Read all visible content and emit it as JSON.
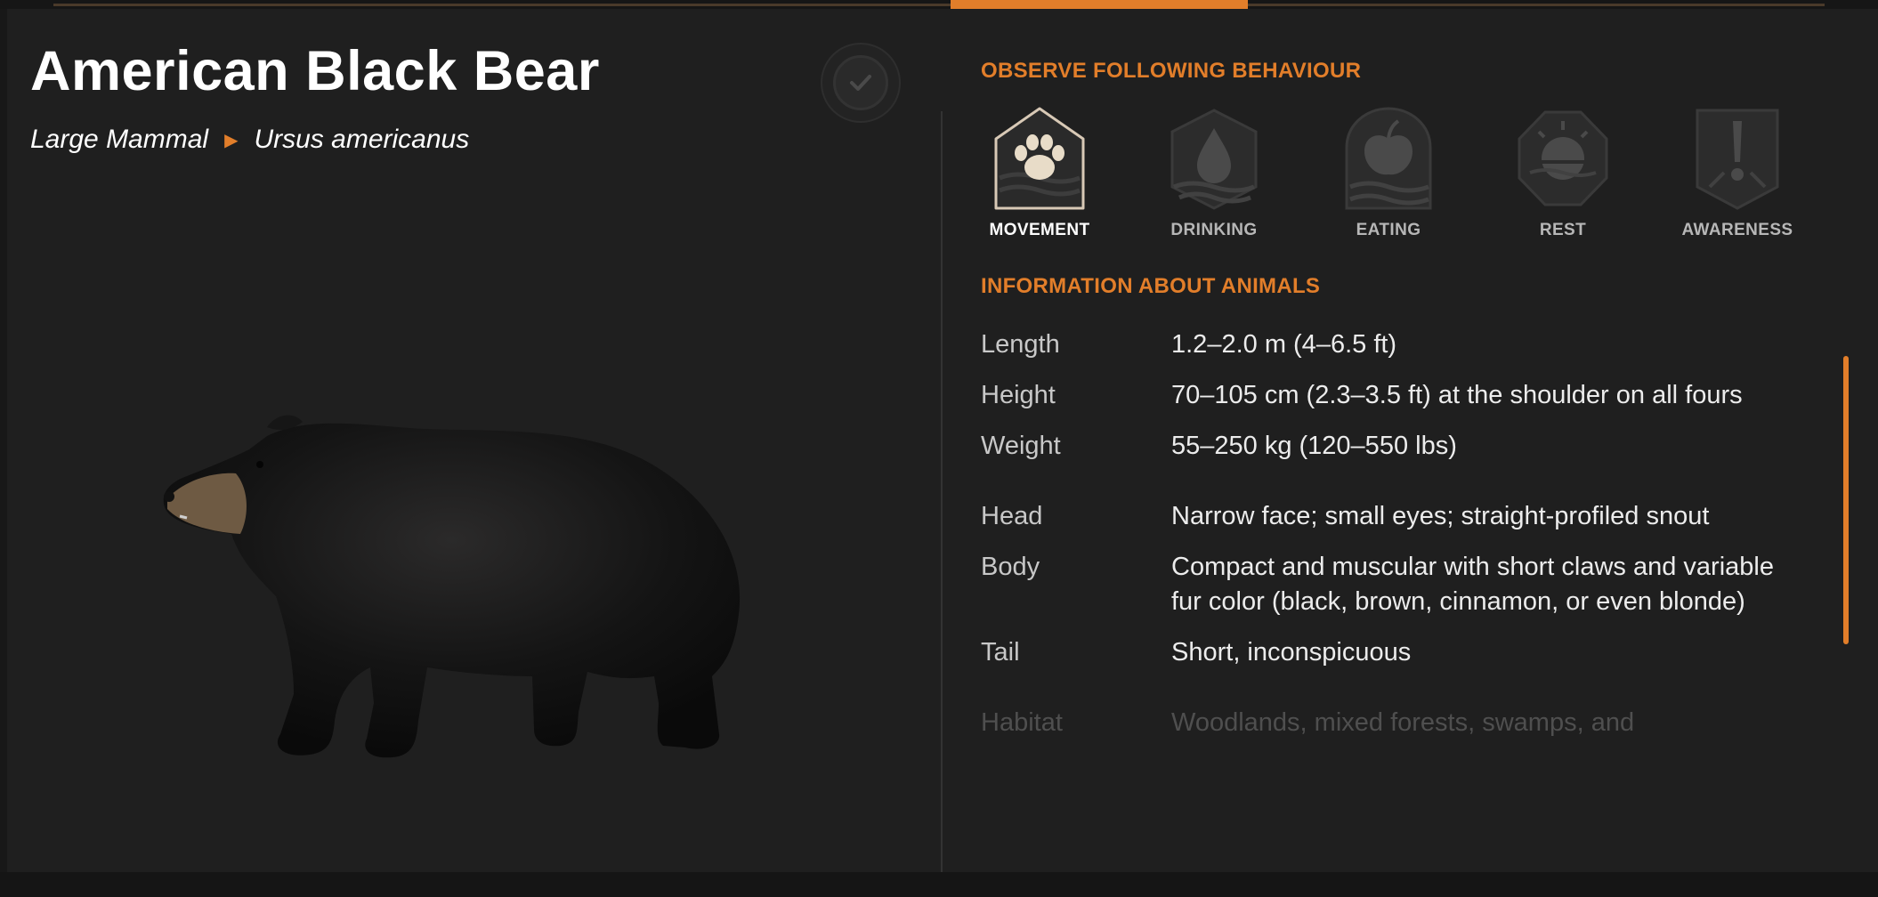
{
  "animal": {
    "name": "American Black Bear",
    "category": "Large Mammal",
    "species": "Ursus americanus"
  },
  "behaviour_section": {
    "heading": "OBSERVE FOLLOWING BEHAVIOUR",
    "items": [
      {
        "label": "MOVEMENT",
        "icon": "paw-icon",
        "active": true
      },
      {
        "label": "DRINKING",
        "icon": "water-drop-icon",
        "active": false
      },
      {
        "label": "EATING",
        "icon": "apple-icon",
        "active": false
      },
      {
        "label": "REST",
        "icon": "sun-icon",
        "active": false
      },
      {
        "label": "AWARENESS",
        "icon": "exclamation-icon",
        "active": false
      }
    ]
  },
  "info_section": {
    "heading": "INFORMATION ABOUT ANIMALS",
    "rows": [
      {
        "key": "Length",
        "value": "1.2–2.0 m (4–6.5 ft)"
      },
      {
        "key": "Height",
        "value": "70–105 cm (2.3–3.5 ft) at the shoulder on all fours"
      },
      {
        "key": "Weight",
        "value": "55–250 kg (120–550 lbs)"
      },
      {
        "key": "Head",
        "value": "Narrow face; small eyes; straight-profiled snout"
      },
      {
        "key": "Body",
        "value": "Compact and muscular with short claws and variable fur color (black, brown, cinnamon, or even blonde)"
      },
      {
        "key": "Tail",
        "value": "Short, inconspicuous"
      },
      {
        "key": "Habitat",
        "value": "Woodlands, mixed forests, swamps, and"
      }
    ]
  },
  "colors": {
    "accent": "#e27e2a",
    "background": "#1f1f1f",
    "text": "#ffffff"
  }
}
